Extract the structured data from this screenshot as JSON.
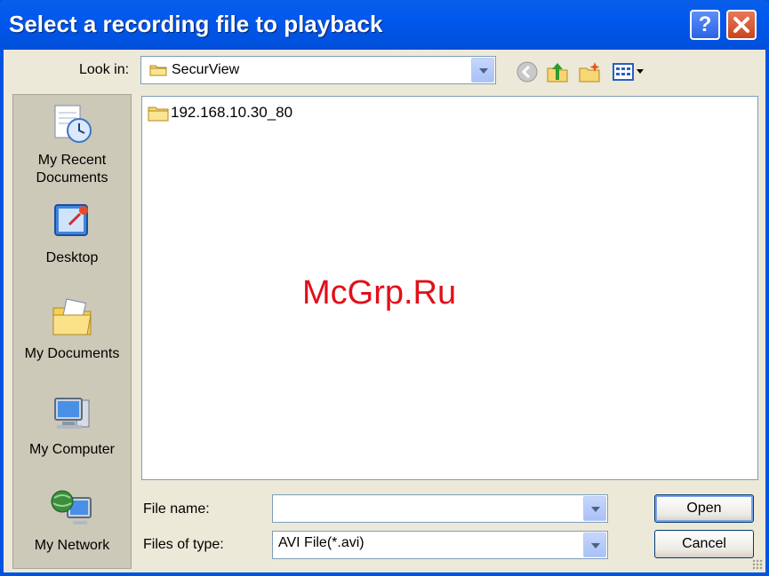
{
  "window": {
    "title": "Select a recording file to playback",
    "help_button": "?",
    "close_button": "✕"
  },
  "lookin": {
    "label": "Look in:",
    "value": "SecurView"
  },
  "toolbar": {
    "icons": [
      "back-icon",
      "up-folder-icon",
      "new-folder-icon",
      "view-menu-icon"
    ]
  },
  "places": [
    {
      "label": "My Recent Documents",
      "line1": "My Recent",
      "line2": "Documents",
      "icon": "recent-documents-icon"
    },
    {
      "label": "Desktop",
      "icon": "desktop-icon"
    },
    {
      "label": "My Documents",
      "icon": "my-documents-icon"
    },
    {
      "label": "My Computer",
      "icon": "my-computer-icon"
    },
    {
      "label": "My Network",
      "icon": "my-network-icon"
    }
  ],
  "files": [
    {
      "name": "192.168.10.30_80",
      "icon": "folder-icon"
    }
  ],
  "watermark": "McGrp.Ru",
  "filename": {
    "label": "File name:",
    "value": ""
  },
  "filetype": {
    "label": "Files of type:",
    "value": "AVI File(*.avi)"
  },
  "buttons": {
    "open": "Open",
    "cancel": "Cancel"
  },
  "colors": {
    "titlebar": "#0054e3",
    "dialog_bg": "#ece9d8",
    "watermark": "#e0101a"
  }
}
